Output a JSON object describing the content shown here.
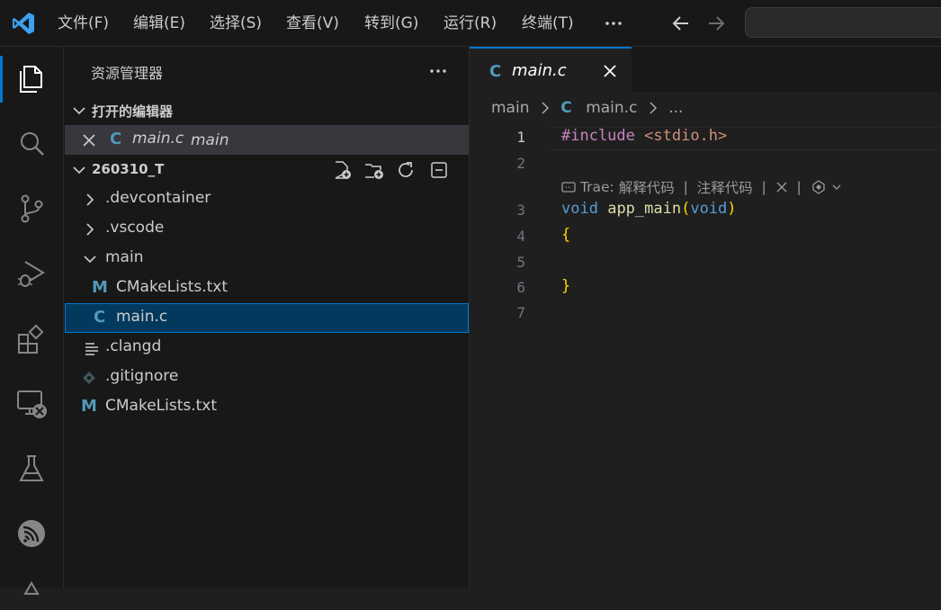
{
  "titlebar": {
    "menus": [
      "文件(F)",
      "编辑(E)",
      "选择(S)",
      "查看(V)",
      "转到(G)",
      "运行(R)",
      "终端(T)"
    ]
  },
  "sidebar": {
    "title": "资源管理器",
    "open_editors": {
      "label": "打开的编辑器",
      "items": [
        {
          "icon": "C",
          "name": "main.c",
          "desc": "main"
        }
      ]
    },
    "workspace": {
      "label": "260310_T",
      "tree": [
        {
          "name": ".devcontainer",
          "type": "folder",
          "expanded": false
        },
        {
          "name": ".vscode",
          "type": "folder",
          "expanded": false
        },
        {
          "name": "main",
          "type": "folder",
          "expanded": true
        },
        {
          "name": "CMakeLists.txt",
          "type": "cmake",
          "icon": "M"
        },
        {
          "name": "main.c",
          "type": "c",
          "icon": "C",
          "selected": true
        },
        {
          "name": ".clangd",
          "type": "text"
        },
        {
          "name": ".gitignore",
          "type": "git"
        },
        {
          "name": "CMakeLists.txt",
          "type": "cmake",
          "icon": "M"
        }
      ]
    }
  },
  "editor": {
    "tab": {
      "icon": "C",
      "label": "main.c"
    },
    "breadcrumb": [
      "main",
      "C",
      "main.c",
      "..."
    ],
    "line_numbers": [
      "1",
      "2",
      "3",
      "4",
      "5",
      "6",
      "7"
    ],
    "code": {
      "l1_directive": "#include",
      "l1_header": "<stdio.h>",
      "l3_void": "void",
      "l3_fn": "app_main",
      "l3_open": "(",
      "l3_param": "void",
      "l3_close": ")",
      "l4": "{",
      "l6": "}"
    },
    "codelens": {
      "prefix": "Trae: ",
      "explain": "解释代码",
      "sep": " | ",
      "comment": "注释代码"
    }
  },
  "colors": {
    "accent": "#0078d4",
    "selection": "#04395e",
    "file_icon": "#519aba"
  }
}
